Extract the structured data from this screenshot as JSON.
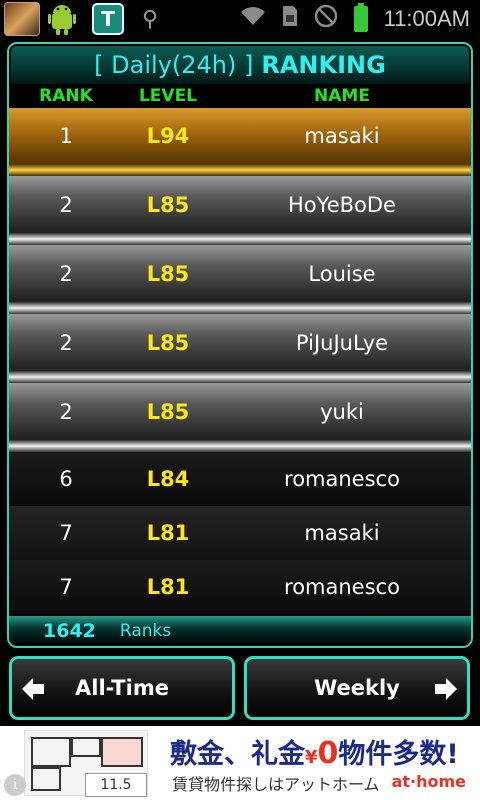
{
  "status_bar": {
    "time": "11:00AM",
    "icons": [
      "game-app-icon",
      "android-debug-icon",
      "shield-app-icon",
      "usb-icon",
      "wifi-icon",
      "sim-icon",
      "no-signal-icon",
      "battery-charging-icon"
    ]
  },
  "ranking": {
    "title_prefix": "[ Daily(24h) ]",
    "title": "RANKING",
    "columns": {
      "rank": "RANK",
      "level": "LEVEL",
      "name": "NAME"
    },
    "rows": [
      {
        "rank": "1",
        "level": "L94",
        "name": "masaki",
        "style": "gold"
      },
      {
        "rank": "2",
        "level": "L85",
        "name": "HoYeBoDe",
        "style": "silver"
      },
      {
        "rank": "2",
        "level": "L85",
        "name": "Louise",
        "style": "silver"
      },
      {
        "rank": "2",
        "level": "L85",
        "name": "PiJuJuLye",
        "style": "silver"
      },
      {
        "rank": "2",
        "level": "L85",
        "name": "yuki",
        "style": "silver"
      },
      {
        "rank": "6",
        "level": "L84",
        "name": "romanesco",
        "style": "plain"
      },
      {
        "rank": "7",
        "level": "L81",
        "name": "masaki",
        "style": "plain"
      },
      {
        "rank": "7",
        "level": "L81",
        "name": "romanesco",
        "style": "plain"
      }
    ],
    "total_count": "1642",
    "total_label": "Ranks"
  },
  "nav": {
    "left_label": "All-Time",
    "right_label": "Weekly"
  },
  "ad": {
    "headline_a": "敷金、礼金",
    "headline_yen": "¥",
    "headline_zero": "0",
    "headline_b": "物件多数!",
    "sub": "賃貸物件探しはアットホーム",
    "brand": "at·home",
    "floorplan_size": "11.5",
    "info": "i"
  },
  "colors": {
    "accent": "#2fd7b4",
    "title": "#2ff0f0",
    "column_header": "#22e622",
    "level": "#ffe81a",
    "gold_row": "#a86b10",
    "silver_row": "#5a5a5a"
  }
}
